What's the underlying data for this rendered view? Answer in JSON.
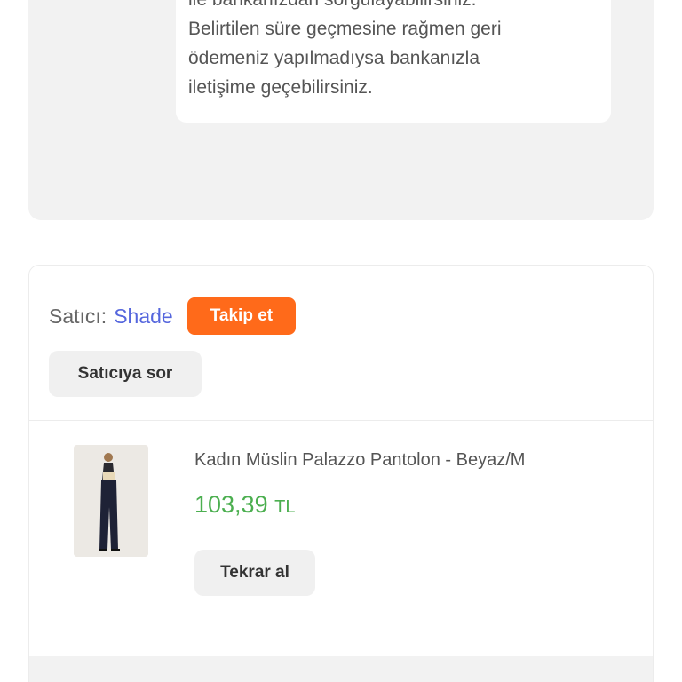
{
  "refund_info": {
    "text_line1": "ile bankanızdan sorgulayabilirsiniz.",
    "text_line2": "Belirtilen süre geçmesine rağmen geri",
    "text_line3": "ödemeniz yapılmadıysa bankanızla",
    "text_line4": "iletişime geçebilirsiniz."
  },
  "seller": {
    "label": "Satıcı:",
    "name": "Shade",
    "follow_label": "Takip et",
    "ask_label": "Satıcıya sor"
  },
  "product": {
    "title": "Kadın Müslin Palazzo Pantolon - Beyaz/M",
    "price": "103,39",
    "currency": "TL",
    "rebuy_label": "Tekrar al"
  },
  "colors": {
    "accent": "#ff6a1a",
    "seller_link": "#5566dd",
    "price": "#4caf50"
  }
}
